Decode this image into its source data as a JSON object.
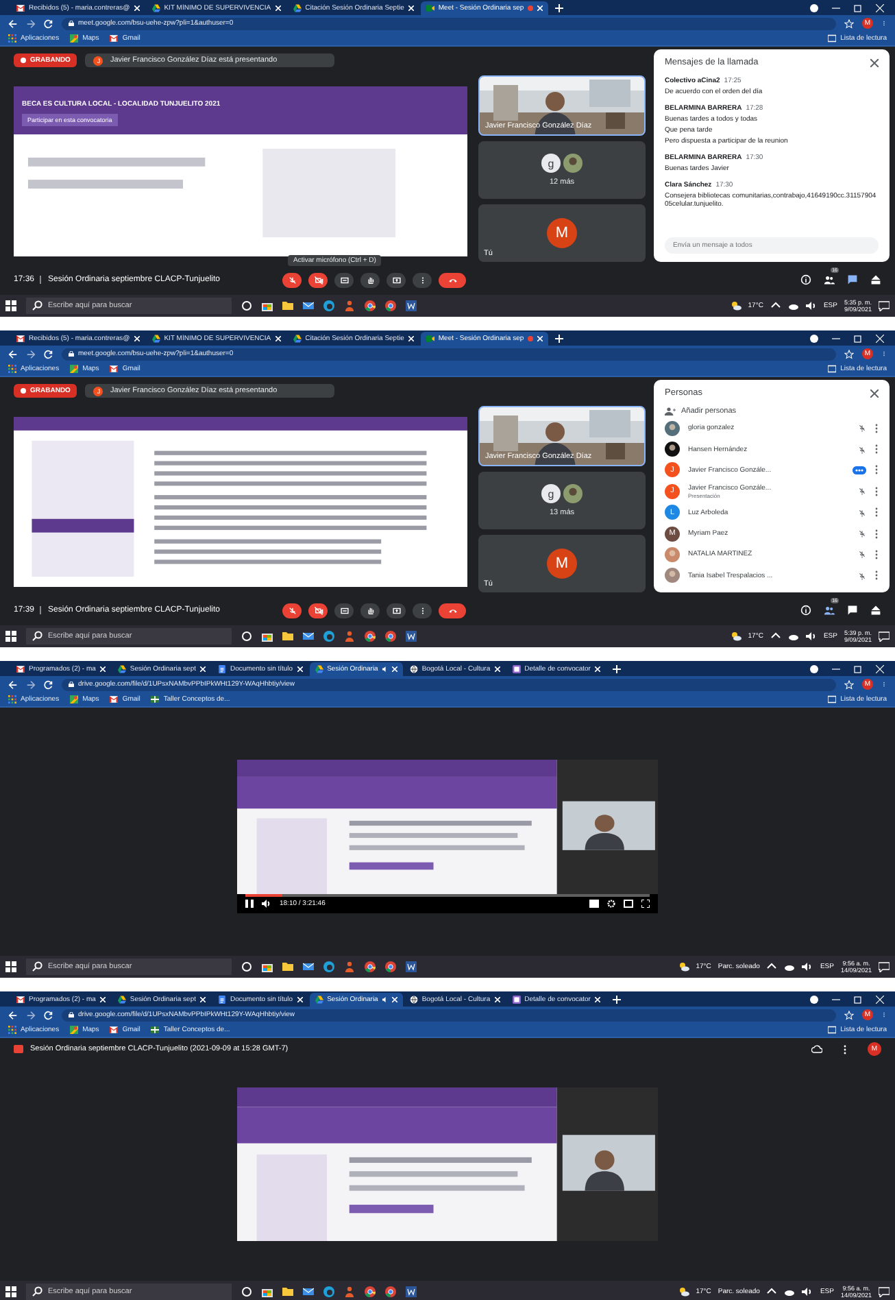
{
  "screens": [
    {
      "kind": "meet",
      "tabs": [
        {
          "title": "Recibidos (5) - maria.contreras@",
          "kind": "mail",
          "selected": false,
          "recording": false
        },
        {
          "title": "KIT MÍNIMO DE SUPERVIVENCIA",
          "kind": "drive",
          "selected": false,
          "recording": false
        },
        {
          "title": "Citación Sesión Ordinaria Septie",
          "kind": "drive",
          "selected": false,
          "recording": false
        },
        {
          "title": "Meet - Sesión Ordinaria sep",
          "kind": "meet",
          "selected": true,
          "recording": true
        }
      ],
      "address": "meet.google.com/bsu-uehe-zpw?pli=1&authuser=0",
      "account": "M",
      "bookmarks": [
        {
          "label": "Aplicaciones",
          "kind": "apps"
        },
        {
          "label": "Maps",
          "kind": "maps"
        },
        {
          "label": "Gmail",
          "kind": "mail"
        }
      ],
      "reading_list": "Lista de lectura",
      "meet": {
        "recording": "GRABANDO",
        "presenter_initial": "J",
        "presenter_text": "Javier Francisco González Díaz está presentando",
        "shared": {
          "kind": "banner",
          "heading": "BECA ES CULTURA LOCAL - LOCALIDAD TUNJUELITO 2021",
          "button": "Participar en esta convocatoria"
        },
        "tiles": [
          {
            "kind": "video",
            "label": "Javier Francisco González Díaz"
          },
          {
            "kind": "more",
            "initial": "g",
            "label": "12 más"
          },
          {
            "kind": "self",
            "initial": "M",
            "label": "Tú"
          }
        ],
        "tooltip": "Activar micrófono (Ctrl + D)",
        "meeting_time": "17:36",
        "meeting_title": "Sesión Ordinaria septiembre CLACP-Tunjuelito",
        "controls": [
          {
            "kind": "mic",
            "off": true
          },
          {
            "kind": "camera",
            "off": true
          },
          {
            "kind": "captions",
            "off": false
          },
          {
            "kind": "hand",
            "off": false
          },
          {
            "kind": "present",
            "off": false
          },
          {
            "kind": "more",
            "off": false
          },
          {
            "kind": "hangup"
          }
        ],
        "side_buttons": [
          {
            "kind": "info",
            "selected": false
          },
          {
            "kind": "people",
            "selected": false,
            "badge": "16"
          },
          {
            "kind": "chat",
            "selected": true
          },
          {
            "kind": "activities",
            "selected": false
          }
        ],
        "panel": {
          "kind": "chat",
          "title": "Mensajes de la llamada",
          "messages": [
            {
              "sender": "Colectivo aCina2",
              "time": "17:25",
              "lines": [
                "De acuerdo con el orden del día"
              ]
            },
            {
              "sender": "BELARMINA BARRERA",
              "time": "17:28",
              "lines": [
                "Buenas tardes a todos y todas",
                "Que pena tarde",
                "Pero dispuesta a participar de la reunion"
              ]
            },
            {
              "sender": "BELARMINA BARRERA",
              "time": "17:30",
              "lines": [
                "Buenas tardes Javier"
              ]
            },
            {
              "sender": "Clara Sánchez",
              "time": "17:30",
              "lines": [
                "Consejera bibliotecas comunitarias,contrabajo,41649190cc.3115790405celular.tunjuelito."
              ]
            }
          ],
          "placeholder": "Envía un mensaje a todos"
        }
      },
      "taskbar": {
        "search": "Escribe aquí para buscar",
        "weather": "17°C",
        "language": "ESP",
        "time": "5:35 p. m.",
        "date": "9/09/2021"
      }
    },
    {
      "kind": "meet",
      "tabs": [
        {
          "title": "Recibidos (5) - maria.contreras@",
          "kind": "mail",
          "selected": false,
          "recording": false
        },
        {
          "title": "KIT MÍNIMO DE SUPERVIVENCIA",
          "kind": "drive",
          "selected": false,
          "recording": false
        },
        {
          "title": "Citación Sesión Ordinaria Septie",
          "kind": "drive",
          "selected": false,
          "recording": false
        },
        {
          "title": "Meet - Sesión Ordinaria sep",
          "kind": "meet",
          "selected": true,
          "recording": true
        }
      ],
      "address": "meet.google.com/bsu-uehe-zpw?pli=1&authuser=0",
      "account": "M",
      "bookmarks": [
        {
          "label": "Aplicaciones",
          "kind": "apps"
        },
        {
          "label": "Maps",
          "kind": "maps"
        },
        {
          "label": "Gmail",
          "kind": "mail"
        }
      ],
      "reading_list": "Lista de lectura",
      "meet": {
        "recording": "GRABANDO",
        "presenter_initial": "J",
        "presenter_text": "Javier Francisco González Díaz está presentando",
        "shared": {
          "kind": "article"
        },
        "tiles": [
          {
            "kind": "video",
            "label": "Javier Francisco González Díaz"
          },
          {
            "kind": "more",
            "initial": "g",
            "label": "13 más"
          },
          {
            "kind": "self",
            "initial": "M",
            "label": "Tú"
          }
        ],
        "meeting_time": "17:39",
        "meeting_title": "Sesión Ordinaria septiembre CLACP-Tunjuelito",
        "controls": [
          {
            "kind": "mic",
            "off": true
          },
          {
            "kind": "camera",
            "off": true
          },
          {
            "kind": "captions",
            "off": false
          },
          {
            "kind": "hand",
            "off": false
          },
          {
            "kind": "present",
            "off": false
          },
          {
            "kind": "more",
            "off": false
          },
          {
            "kind": "hangup"
          }
        ],
        "side_buttons": [
          {
            "kind": "info",
            "selected": false
          },
          {
            "kind": "people",
            "selected": true,
            "badge": "16"
          },
          {
            "kind": "chat",
            "selected": false
          },
          {
            "kind": "activities",
            "selected": false
          }
        ],
        "panel": {
          "kind": "people",
          "title": "Personas",
          "add": "Añadir personas",
          "people": [
            {
              "name": "gloria gonzalez",
              "color": "#546e7a",
              "muted": true
            },
            {
              "name": "Hansen Hernández",
              "color": "#111111",
              "muted": true
            },
            {
              "name": "Javier Francisco Gonzále...",
              "kind": "letter",
              "initial": "J",
              "color": "#f4511e",
              "muted": false
            },
            {
              "name": "Javier Francisco Gonzále...",
              "subtitle": "Presentación",
              "kind": "letter",
              "initial": "J",
              "color": "#f4511e",
              "muted": true
            },
            {
              "name": "Luz Arboleda",
              "kind": "letter",
              "initial": "L",
              "color": "#1e88e5",
              "muted": true
            },
            {
              "name": "Myriam Paez",
              "kind": "letter",
              "initial": "M",
              "color": "#6d4c41",
              "muted": true
            },
            {
              "name": "NATALIA MARTINEZ",
              "color": "#c98a6b",
              "muted": true
            },
            {
              "name": "Tania Isabel Trespalacios ...",
              "color": "#a1887f",
              "muted": true
            }
          ]
        }
      },
      "taskbar": {
        "search": "Escribe aquí para buscar",
        "weather": "17°C",
        "language": "ESP",
        "time": "5:39 p. m.",
        "date": "9/09/2021"
      }
    },
    {
      "kind": "drive",
      "tabs": [
        {
          "title": "Programados (2) - ma",
          "kind": "mail",
          "selected": false,
          "audio": false
        },
        {
          "title": "Sesión Ordinaria sept",
          "kind": "drive",
          "selected": false,
          "audio": false
        },
        {
          "title": "Documento sin título",
          "kind": "docs",
          "selected": false,
          "audio": false
        },
        {
          "title": "Sesión Ordinaria",
          "kind": "drive",
          "selected": true,
          "audio": true
        },
        {
          "title": "Bogotá Local - Cultura",
          "kind": "web",
          "selected": false,
          "audio": false
        },
        {
          "title": "Detalle de convocator",
          "kind": "form",
          "selected": false,
          "audio": false
        }
      ],
      "address": "drive.google.com/file/d/1UPsxNAMbvPPbIPkWHt129Y-WAqHhbtiy/view",
      "account": "M",
      "bookmarks": [
        {
          "label": "Aplicaciones",
          "kind": "apps"
        },
        {
          "label": "Maps",
          "kind": "maps"
        },
        {
          "label": "Gmail",
          "kind": "mail"
        },
        {
          "label": "Taller Conceptos de...",
          "kind": "sheet"
        }
      ],
      "reading_list": "Lista de lectura",
      "player": {
        "time": "18:10 / 3:21:46",
        "level": 0.09
      },
      "taskbar": {
        "search": "Escribe aquí para buscar",
        "weather": "17°C",
        "weather_text": "Parc. soleado",
        "language": "ESP",
        "time": "9:56 a. m.",
        "date": "14/09/2021"
      }
    },
    {
      "kind": "drive",
      "tabs": [
        {
          "title": "Programados (2) - ma",
          "kind": "mail",
          "selected": false,
          "audio": false
        },
        {
          "title": "Sesión Ordinaria sept",
          "kind": "drive",
          "selected": false,
          "audio": false
        },
        {
          "title": "Documento sin título",
          "kind": "docs",
          "selected": false,
          "audio": false
        },
        {
          "title": "Sesión Ordinaria",
          "kind": "drive",
          "selected": true,
          "audio": true
        },
        {
          "title": "Bogotá Local - Cultura",
          "kind": "web",
          "selected": false,
          "audio": false
        },
        {
          "title": "Detalle de convocator",
          "kind": "form",
          "selected": false,
          "audio": false
        }
      ],
      "address": "drive.google.com/file/d/1UPsxNAMbvPPbIPkWHt129Y-WAqHhbtiy/view",
      "account": "M",
      "bookmarks": [
        {
          "label": "Aplicaciones",
          "kind": "apps"
        },
        {
          "label": "Maps",
          "kind": "maps"
        },
        {
          "label": "Gmail",
          "kind": "mail"
        },
        {
          "label": "Taller Conceptos de...",
          "kind": "sheet"
        }
      ],
      "reading_list": "Lista de lectura",
      "file_title": "Sesión Ordinaria septiembre CLACP-Tunjuelito (2021-09-09 at 15:28 GMT-7)",
      "file_account": "M",
      "taskbar": {
        "search": "Escribe aquí para buscar",
        "weather": "17°C",
        "weather_text": "Parc. soleado",
        "language": "ESP",
        "time": "9:56 a. m.",
        "date": "14/09/2021"
      }
    }
  ]
}
